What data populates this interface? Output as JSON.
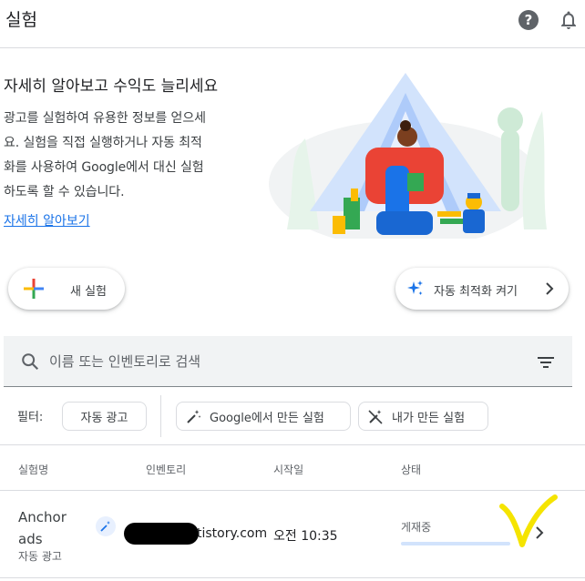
{
  "header": {
    "title": "실험",
    "help_icon_glyph": "?",
    "icons": [
      "help-icon",
      "bell-icon"
    ]
  },
  "hero": {
    "heading": "자세히 알아보고 수익도 늘리세요",
    "body_lines": [
      "광고를 실험하여 유용한 정보를 얻으세",
      "요. 실험을 직접 실행하거나 자동 최적",
      "화를 사용하여 Google에서 대신 실험",
      "하도록 할 수 있습니다."
    ],
    "link": "자세히 알아보기"
  },
  "actions": {
    "new_experiment": "새 실험",
    "auto_optimize": "자동 최적화 켜기"
  },
  "search": {
    "placeholder": "이름 또는 인벤토리로 검색",
    "value": ""
  },
  "filters": {
    "label": "필터:",
    "chips": [
      "자동 광고",
      "Google에서 만든 실험",
      "내가 만든 실험"
    ]
  },
  "table": {
    "columns": [
      "실험명",
      "인벤토리",
      "시작일",
      "상태"
    ],
    "rows": [
      {
        "name": "Anchor ads",
        "type": "자동 광고",
        "inventory": "tistory.com",
        "start": "오전 10:35",
        "status": "게재중"
      }
    ]
  },
  "colors": {
    "accent": "#1a73e8",
    "search_bg": "#f1f3f4",
    "highlight_mark": "#f5e400"
  }
}
